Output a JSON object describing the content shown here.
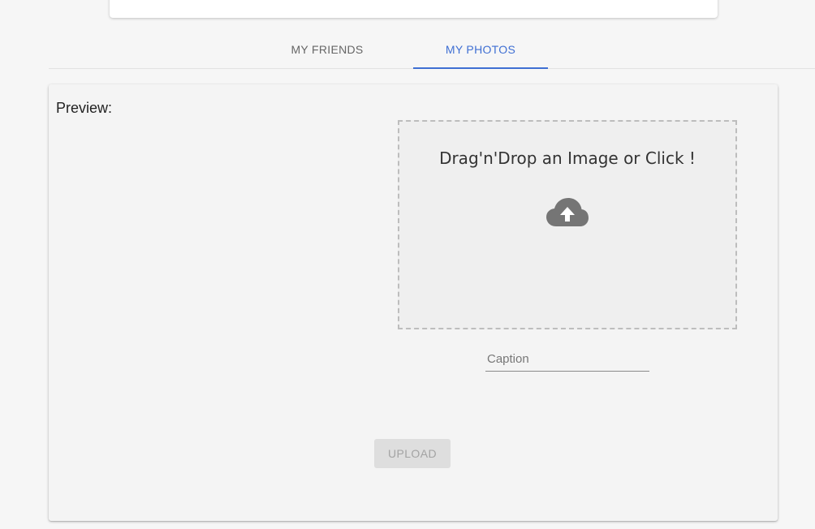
{
  "tabs": [
    {
      "label": "MY FRIENDS",
      "active": false
    },
    {
      "label": "MY PHOTOS",
      "active": true
    }
  ],
  "colors": {
    "accent": "#3f6fd3",
    "panel_bg": "#f4f4f4",
    "dropzone_bg": "#efefef",
    "disabled_button_bg": "#dedede"
  },
  "upload_panel": {
    "preview_label": "Preview:",
    "dropzone": {
      "text": "Drag'n'Drop an Image or Click !",
      "icon": "cloud-upload-icon"
    },
    "caption": {
      "placeholder": "Caption",
      "value": ""
    },
    "upload_button": {
      "label": "UPLOAD",
      "disabled": true
    }
  }
}
